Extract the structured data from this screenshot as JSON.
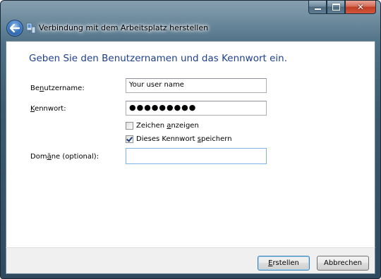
{
  "window": {
    "title": "Verbindung mit dem Arbeitsplatz herstellen",
    "caption_buttons": [
      "minimize",
      "maximize",
      "close"
    ]
  },
  "header": {
    "back_icon": "back-arrow-icon",
    "app_icon": "network-icon"
  },
  "main": {
    "heading": "Geben Sie den Benutzernamen und das Kennwort ein.",
    "username": {
      "label_pre": "Be",
      "label_access": "n",
      "label_post": "utzername:",
      "value": "Your user name"
    },
    "password": {
      "label_pre": "",
      "label_access": "K",
      "label_post": "ennwort:",
      "value": "●●●●●●●●●"
    },
    "show_chars": {
      "label_pre": "Zeichen ",
      "label_access": "a",
      "label_post": "nzeigen",
      "checked": false
    },
    "save_password": {
      "label_pre": "Dieses Kennwort ",
      "label_access": "s",
      "label_post": "peichern",
      "checked": true
    },
    "domain": {
      "label_pre": "Dom",
      "label_access": "ä",
      "label_post": "ne (optional):",
      "value": ""
    }
  },
  "footer": {
    "create_pre": "",
    "create_access": "E",
    "create_post": "rstellen",
    "cancel_label": "Abbrechen"
  },
  "colors": {
    "heading": "#1e3f8e",
    "frame": "#3b5a70",
    "close_button": "#c03e24"
  }
}
